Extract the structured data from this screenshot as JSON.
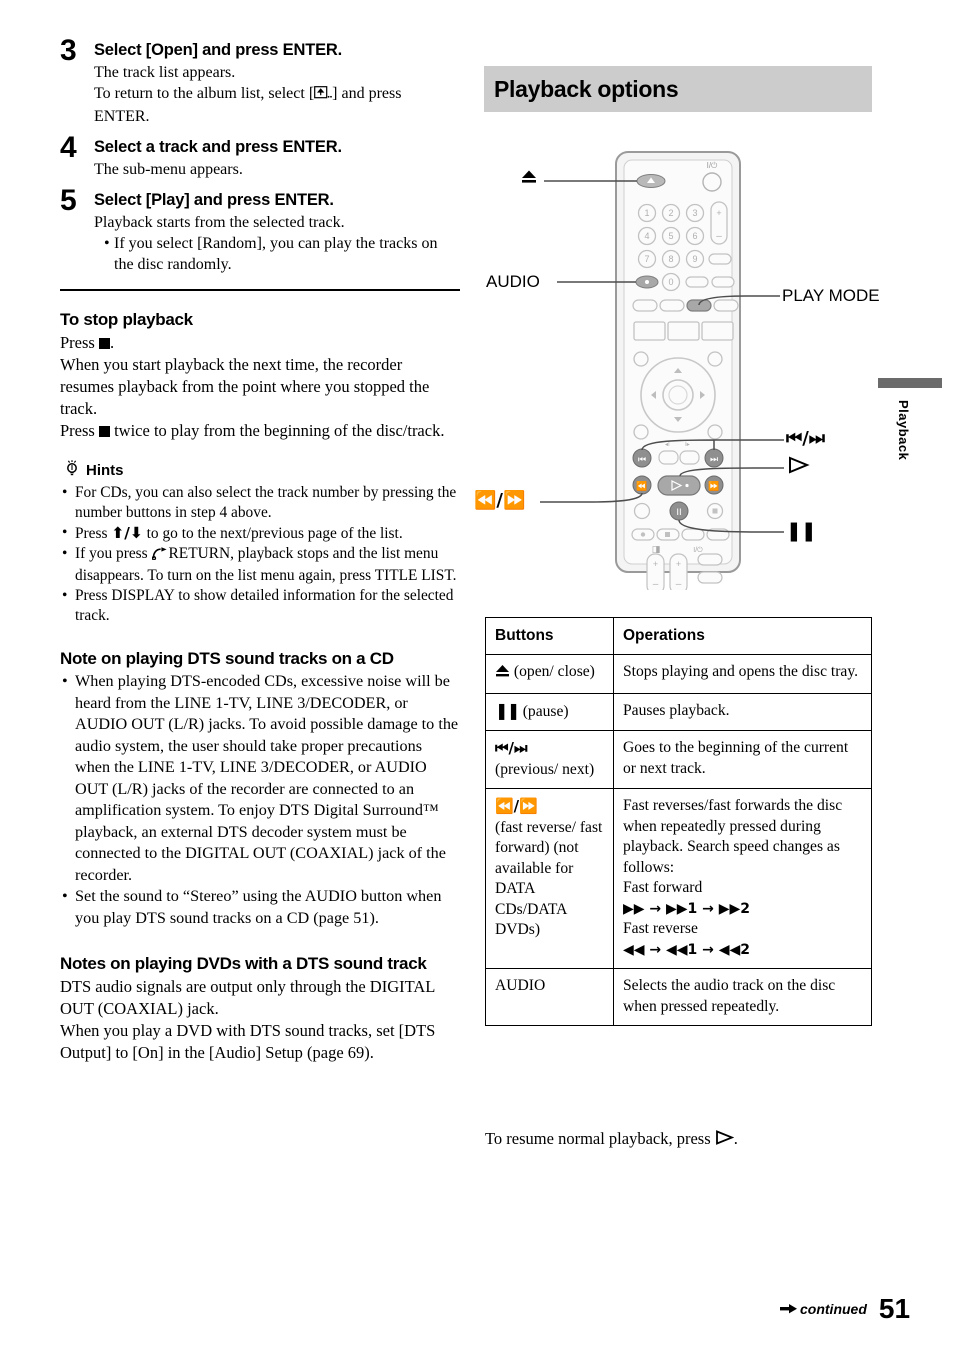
{
  "steps": [
    {
      "number": "3",
      "title": "Select [Open] and press ENTER.",
      "line1": "The track list appears.",
      "line2_a": "To return to the album list, select [",
      "line2_b": "] and press ENTER."
    },
    {
      "number": "4",
      "title": "Select a track and press ENTER.",
      "line1": "The sub-menu appears."
    },
    {
      "number": "5",
      "title": "Select [Play] and press ENTER.",
      "line1": "Playback starts from the selected track.",
      "bullet": "If you select [Random], you can play the tracks on the disc randomly."
    }
  ],
  "stop_playback": {
    "heading": "To stop playback",
    "press_prefix": "Press",
    "press_suffix": ".",
    "para1": "When you start playback the next time, the recorder resumes playback from the point where you stopped the track.",
    "press2_prefix": "Press",
    "press2_suffix": "twice to play from the beginning of the disc/track."
  },
  "hints": {
    "heading": "Hints",
    "items": [
      "For CDs, you can also select the track number by pressing the number buttons in step 4 above.",
      "Press ↑/↓ to go to the next/previous page of the list.",
      "If you press ↩ RETURN, playback stops and the list menu disappears. To turn on the list menu again, press TITLE LIST.",
      "Press DISPLAY to show detailed information for the selected track."
    ],
    "item2_pre": "Press",
    "item2_post": "to go to the next/previous page of the list.",
    "item3_pre": "If you press",
    "item3_post": "RETURN, playback stops and the list menu disappears. To turn on the list menu again, press TITLE LIST."
  },
  "dts_cd_note": {
    "heading": "Note on playing DTS sound tracks on a CD",
    "items": [
      "When playing DTS-encoded CDs, excessive noise will be heard from the LINE 1-TV, LINE 3/DECODER, or AUDIO OUT (L/R) jacks. To avoid possible damage to the audio system, the user should take proper precautions when the LINE 1-TV, LINE 3/DECODER, or AUDIO OUT (L/R) jacks of the recorder are connected to an amplification system. To enjoy DTS Digital Surround™ playback, an external DTS decoder system must be connected to the DIGITAL OUT (COAXIAL) jack of the recorder.",
      "Set the sound to “Stereo” using the AUDIO button when you play DTS sound tracks on a CD (page 51)."
    ]
  },
  "dvd_dts_note": {
    "heading": "Notes on playing DVDs with a DTS sound track",
    "para1": "DTS audio signals are output only through the DIGITAL OUT (COAXIAL) jack.",
    "para2": "When you play a DVD with DTS sound tracks, set [DTS Output] to [On] in the [Audio] Setup (page 69)."
  },
  "section": {
    "title": "Playback options"
  },
  "remote_callouts": [
    {
      "label": "▲",
      "name": "eject-callout"
    },
    {
      "label": "AUDIO",
      "name": "audio-callout"
    },
    {
      "label": "PLAY MODE",
      "name": "play-mode-callout"
    },
    {
      "label": "⏮/⏭",
      "name": "prev-next-callout"
    },
    {
      "label": "▷",
      "name": "play-callout"
    },
    {
      "label": "◀◀/▶▶",
      "name": "scan-callout"
    },
    {
      "label": "⏸",
      "name": "pause-callout"
    }
  ],
  "table": {
    "headers": [
      "Buttons",
      "Operations"
    ],
    "rows": [
      {
        "button_sym": "▲",
        "button_text": "(open/ close)",
        "operation": "Stops playing and opens the disc tray."
      },
      {
        "button_sym": "❙❙",
        "button_text": "(pause)",
        "operation": "Pauses playback."
      },
      {
        "button_sym": "⏮/⏭",
        "button_text": "(previous/ next)",
        "operation": "Goes to the beginning of the current or next track."
      },
      {
        "button_sym": "◀◀/▶▶",
        "button_text": "(fast reverse/ fast forward) (not available for DATA CDs/DATA DVDs)",
        "operation": "Fast reverses/fast forwards the disc when repeatedly pressed during playback. Search speed changes as follows:",
        "ff_label": "Fast forward",
        "ff_seq": "▶▶ → ▶▶1 → ▶▶2",
        "fr_label": "Fast reverse",
        "fr_seq": "◀◀ → ◀◀1 → ◀◀2"
      },
      {
        "button_sym": "",
        "button_text": "AUDIO",
        "operation": "Selects the audio track on the disc when pressed repeatedly."
      }
    ]
  },
  "resume_note": {
    "pre": "To resume normal playback, press",
    "symbol": "▷",
    "post": "."
  },
  "side_tab": {
    "label": "Playback",
    "bar_color": "#6b6b6b"
  },
  "footer": {
    "continued": "continued",
    "page": "51"
  },
  "colors": {
    "header_bar": "#cccccc",
    "remote_body": "#f2f2f2",
    "remote_outline": "#9a9a9a",
    "highlight_button": "#9e9e9e"
  }
}
